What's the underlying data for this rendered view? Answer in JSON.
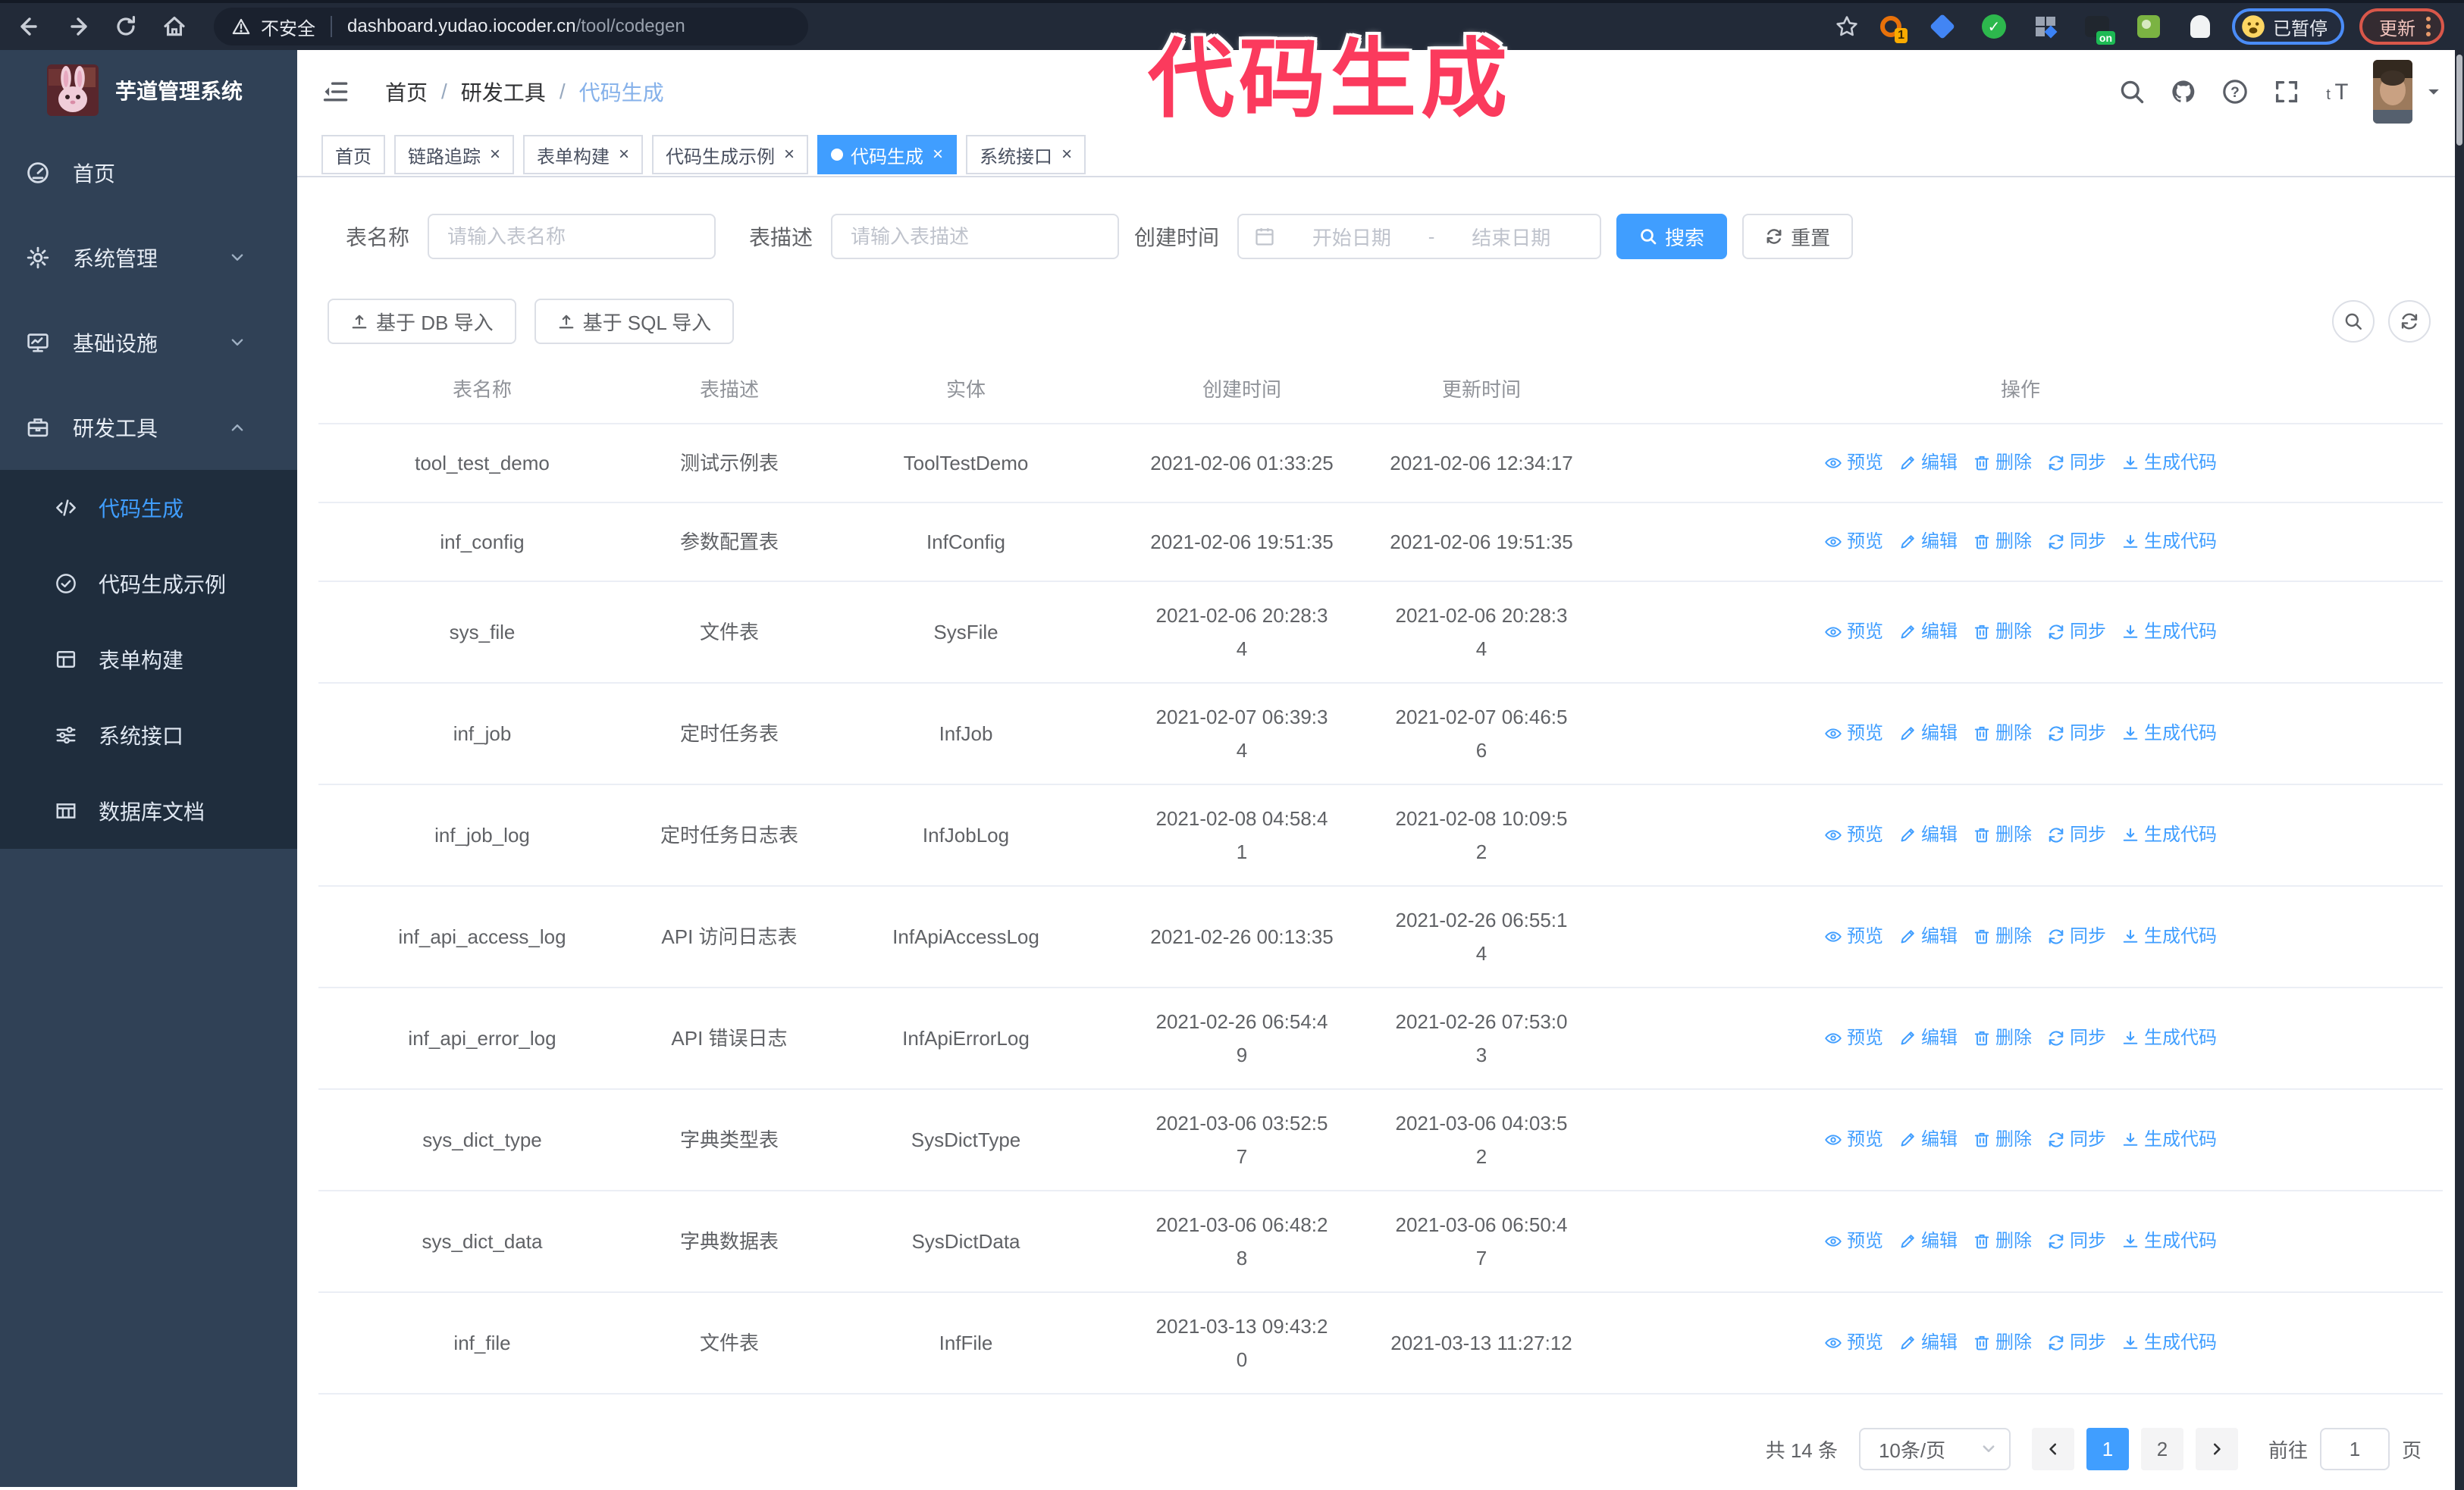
{
  "colors": {
    "accent": "#409eff",
    "annotation": "#fb3a5d",
    "sidebar_bg": "#304156",
    "submenu_bg": "#1f2d3d"
  },
  "annotation": {
    "text": "代码生成"
  },
  "browser": {
    "security_label": "不安全",
    "url_domain": "dashboard.yudao.iocoder.cn",
    "url_path": "/tool/codegen",
    "paused_badge": "已暂停",
    "update_button": "更新",
    "extension_badge": "1",
    "extension_on_badge": "on"
  },
  "sidebar": {
    "logo_title": "芋道管理系统",
    "items": [
      {
        "label": "首页",
        "icon": "dashboard-icon"
      },
      {
        "label": "系统管理",
        "icon": "gear-icon",
        "chevron": "down"
      },
      {
        "label": "基础设施",
        "icon": "monitor-icon",
        "chevron": "down"
      },
      {
        "label": "研发工具",
        "icon": "tools-icon",
        "chevron": "up",
        "expanded": true
      }
    ],
    "subitems": [
      {
        "label": "代码生成",
        "icon": "code-icon",
        "active": true
      },
      {
        "label": "代码生成示例",
        "icon": "example-icon"
      },
      {
        "label": "表单构建",
        "icon": "form-icon"
      },
      {
        "label": "系统接口",
        "icon": "api-icon"
      },
      {
        "label": "数据库文档",
        "icon": "database-icon"
      }
    ]
  },
  "header": {
    "breadcrumb": [
      "首页",
      "研发工具",
      "代码生成"
    ]
  },
  "tabs": [
    {
      "label": "首页",
      "closable": false
    },
    {
      "label": "链路追踪",
      "closable": true
    },
    {
      "label": "表单构建",
      "closable": true
    },
    {
      "label": "代码生成示例",
      "closable": true
    },
    {
      "label": "代码生成",
      "closable": true,
      "active": true
    },
    {
      "label": "系统接口",
      "closable": true
    }
  ],
  "filters": {
    "table_name_label": "表名称",
    "table_name_placeholder": "请输入表名称",
    "table_desc_label": "表描述",
    "table_desc_placeholder": "请输入表描述",
    "create_time_label": "创建时间",
    "date_start_placeholder": "开始日期",
    "date_separator": "-",
    "date_end_placeholder": "结束日期",
    "search_label": "搜索",
    "reset_label": "重置"
  },
  "toolbar": {
    "import_db_label": "基于 DB 导入",
    "import_sql_label": "基于 SQL 导入"
  },
  "table": {
    "columns": [
      "表名称",
      "表描述",
      "实体",
      "创建时间",
      "更新时间",
      "操作"
    ],
    "action_labels": [
      "预览",
      "编辑",
      "删除",
      "同步",
      "生成代码"
    ],
    "rows": [
      {
        "name": "tool_test_demo",
        "description": "测试示例表",
        "entity": "ToolTestDemo",
        "created": "2021-02-06 01:33:25",
        "updated": "2021-02-06 12:34:17",
        "created_wrap": false,
        "updated_wrap": false
      },
      {
        "name": "inf_config",
        "description": "参数配置表",
        "entity": "InfConfig",
        "created": "2021-02-06 19:51:35",
        "updated": "2021-02-06 19:51:35",
        "created_wrap": false,
        "updated_wrap": false
      },
      {
        "name": "sys_file",
        "description": "文件表",
        "entity": "SysFile",
        "created": "2021-02-06 20:28:34",
        "updated": "2021-02-06 20:28:34",
        "created_wrap": true,
        "updated_wrap": true
      },
      {
        "name": "inf_job",
        "description": "定时任务表",
        "entity": "InfJob",
        "created": "2021-02-07 06:39:34",
        "updated": "2021-02-07 06:46:56",
        "created_wrap": true,
        "updated_wrap": true
      },
      {
        "name": "inf_job_log",
        "description": "定时任务日志表",
        "entity": "InfJobLog",
        "created": "2021-02-08 04:58:41",
        "updated": "2021-02-08 10:09:52",
        "created_wrap": true,
        "updated_wrap": true
      },
      {
        "name": "inf_api_access_log",
        "description": "API 访问日志表",
        "entity": "InfApiAccessLog",
        "created": "2021-02-26 00:13:35",
        "updated": "2021-02-26 06:55:14",
        "created_wrap": false,
        "updated_wrap": true
      },
      {
        "name": "inf_api_error_log",
        "description": "API 错误日志",
        "entity": "InfApiErrorLog",
        "created": "2021-02-26 06:54:49",
        "updated": "2021-02-26 07:53:03",
        "created_wrap": true,
        "updated_wrap": true
      },
      {
        "name": "sys_dict_type",
        "description": "字典类型表",
        "entity": "SysDictType",
        "created": "2021-03-06 03:52:57",
        "updated": "2021-03-06 04:03:52",
        "created_wrap": true,
        "updated_wrap": true
      },
      {
        "name": "sys_dict_data",
        "description": "字典数据表",
        "entity": "SysDictData",
        "created": "2021-03-06 06:48:28",
        "updated": "2021-03-06 06:50:47",
        "created_wrap": true,
        "updated_wrap": true
      },
      {
        "name": "inf_file",
        "description": "文件表",
        "entity": "InfFile",
        "created": "2021-03-13 09:43:20",
        "updated": "2021-03-13 11:27:12",
        "created_wrap": true,
        "updated_wrap": false
      }
    ]
  },
  "pagination": {
    "total_label": "共 14 条",
    "page_size": "10条/页",
    "pages": [
      "1",
      "2"
    ],
    "active_page": "1",
    "goto_label": "前往",
    "goto_value": "1",
    "page_suffix": "页"
  }
}
